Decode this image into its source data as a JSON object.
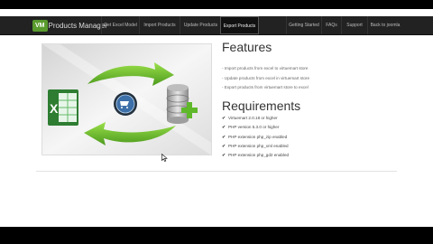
{
  "brand": {
    "badge": "VM",
    "title": "Products Manager"
  },
  "nav": {
    "left": [
      "Get Excel Model",
      "Import Products",
      "Update Products",
      "Export Products"
    ],
    "right": [
      "Getting Started",
      "FAQs",
      "Support",
      "Back to joomla"
    ]
  },
  "features": {
    "heading": "Features",
    "items": [
      "- Import products from excel to virtuemart store",
      "- Update products from excel in virtuemart store",
      "- Export products from virtuemart store to excel"
    ]
  },
  "requirements": {
    "heading": "Requirements",
    "items": [
      "Virtuemart 2.0.18 or higher",
      "PHP version 5.3.0 or higher",
      "PHP extension php_zip enabled",
      "PHP extension php_xml enabled",
      "PHP extension php_gd2 enabled"
    ]
  },
  "colors": {
    "nav_bg": "#222222",
    "brand_green": "#5a9b2e",
    "arrow_green": "#6fbf2a"
  },
  "icons": [
    "excel-icon",
    "database-add-icon",
    "globe-cart-icon",
    "check-icon",
    "mouse-cursor-icon"
  ]
}
